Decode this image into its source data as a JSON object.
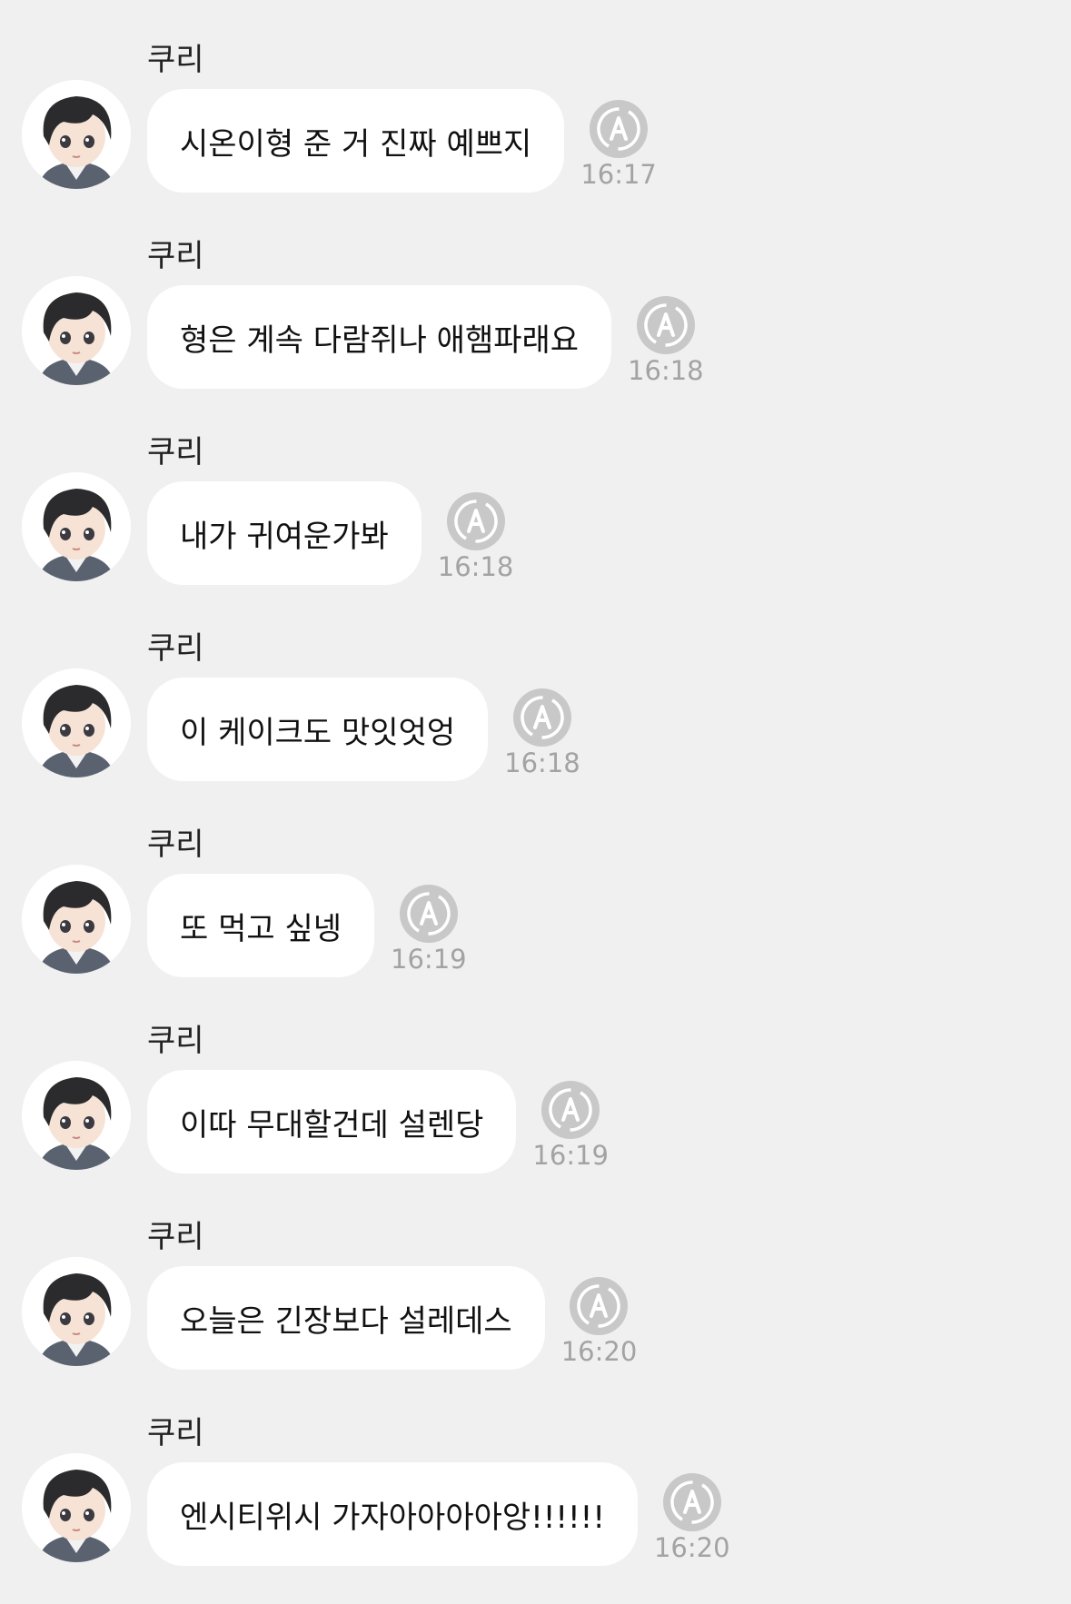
{
  "icons": {
    "avatar": "avatar-chibi-boy",
    "status": "auto-translate-icon"
  },
  "colors": {
    "background": "#f0f0f0",
    "bubble": "#ffffff",
    "time": "#a3a3a3",
    "icon": "#c8c8c8"
  },
  "messages": [
    {
      "sender": "쿠리",
      "text": "시온이형 준 거 진짜 예쁘지",
      "time": "16:17"
    },
    {
      "sender": "쿠리",
      "text": "형은 계속 다람쥐나 애햄파래요",
      "time": "16:18"
    },
    {
      "sender": "쿠리",
      "text": "내가 귀여운가봐",
      "time": "16:18"
    },
    {
      "sender": "쿠리",
      "text": "이 케이크도 맛잇엇엉",
      "time": "16:18"
    },
    {
      "sender": "쿠리",
      "text": "또 먹고 싶넹",
      "time": "16:19"
    },
    {
      "sender": "쿠리",
      "text": "이따 무대할건데 설렌당",
      "time": "16:19"
    },
    {
      "sender": "쿠리",
      "text": "오늘은 긴장보다 설레데스",
      "time": "16:20"
    },
    {
      "sender": "쿠리",
      "text": "엔시티위시 가자아아아아앙!!!!!!",
      "time": "16:20"
    }
  ]
}
